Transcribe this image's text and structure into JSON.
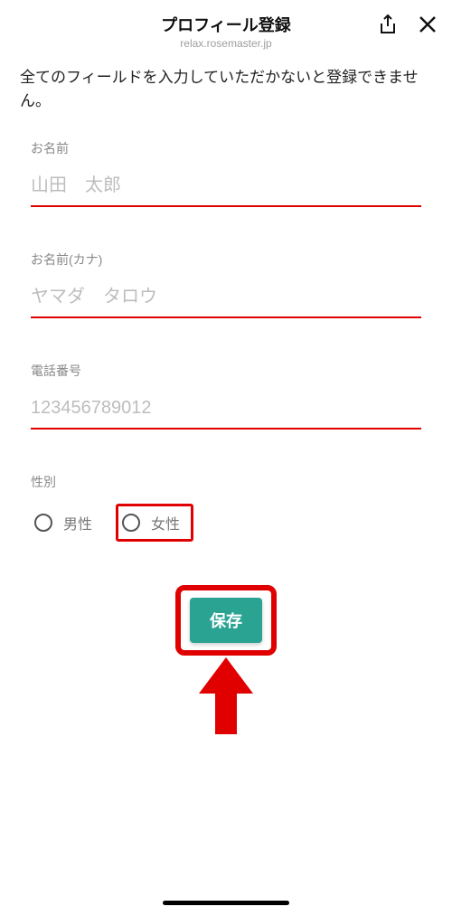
{
  "header": {
    "title": "プロフィール登録",
    "subtitle": "relax.rosemaster.jp"
  },
  "notice": "全てのフィールドを入力していただかないと登録できません。",
  "fields": {
    "name": {
      "label": "お名前",
      "placeholder": "山田　太郎"
    },
    "name_kana": {
      "label": "お名前(カナ)",
      "placeholder": "ヤマダ　タロウ"
    },
    "phone": {
      "label": "電話番号",
      "placeholder": "123456789012"
    },
    "gender": {
      "label": "性別",
      "options": {
        "male": "男性",
        "female": "女性"
      }
    }
  },
  "buttons": {
    "save": "保存"
  }
}
